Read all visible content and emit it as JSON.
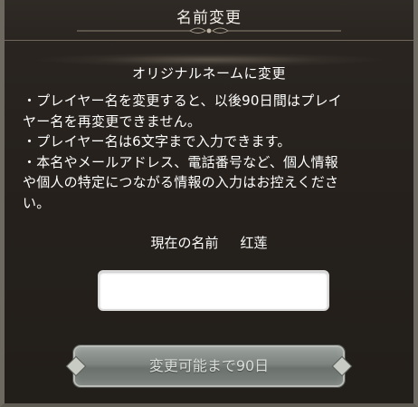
{
  "dialog": {
    "title": "名前変更",
    "subtitle": "オリジナルネームに変更",
    "notes": [
      "・プレイヤー名を変更すると、以後90日間はプレイ",
      "ヤー名を再変更できません。",
      "・プレイヤー名は6文字まで入力できます。",
      "・本名やメールアドレス、電話番号など、個人情報",
      "や個人の特定につながる情報の入力はお控えくださ",
      "い。"
    ],
    "current_name_label": "現在の名前",
    "current_name_value": "红莲",
    "name_input": {
      "value": "",
      "placeholder": ""
    },
    "submit_button_label": "変更可能まで90日",
    "colors": {
      "background": "#26211d",
      "frame": "#6d6860",
      "button": "#7d837f",
      "text": "#ffffff"
    }
  }
}
